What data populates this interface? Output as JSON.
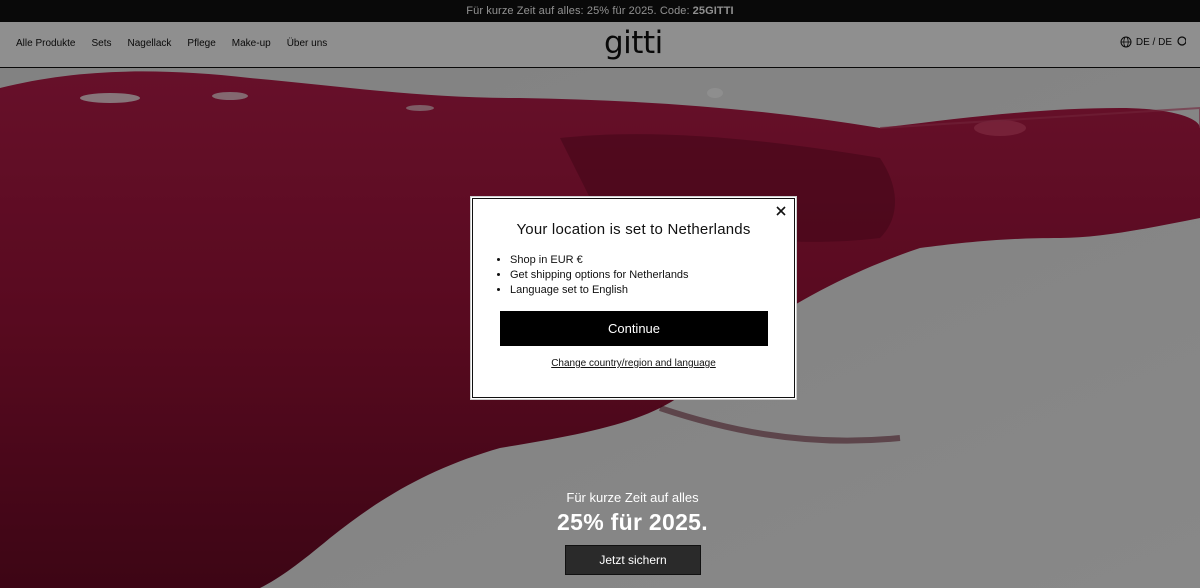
{
  "announcement": {
    "text": "Für kurze Zeit auf alles: 25% für 2025. Code:",
    "code": "25GITTI"
  },
  "header": {
    "logo": "gitti",
    "nav": [
      "Alle Produkte",
      "Sets",
      "Nagellack",
      "Pflege",
      "Make-up",
      "Über uns"
    ],
    "locale": "DE / DE"
  },
  "hero": {
    "subtitle": "Für kurze Zeit auf alles",
    "title": "25% für 2025.",
    "cta": "Jetzt sichern"
  },
  "modal": {
    "title": "Your location is set to Netherlands",
    "items": [
      "Shop in EUR €",
      "Get shipping options for Netherlands",
      "Language set to English"
    ],
    "continue_label": "Continue",
    "change_label": "Change country/region and language"
  },
  "colors": {
    "announcement_bg": "#111111",
    "polish": "#a8163f",
    "overlay": "rgba(0,0,0,0.44)"
  }
}
